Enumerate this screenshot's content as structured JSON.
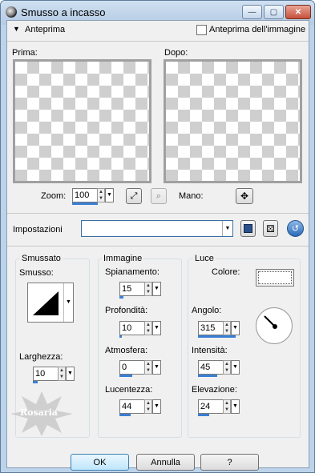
{
  "window": {
    "title": "Smusso a incasso"
  },
  "preview": {
    "toggle_label": "Anteprima",
    "image_preview_checkbox": "Anteprima dell'immagine",
    "before_label": "Prima:",
    "after_label": "Dopo:",
    "zoom_label": "Zoom:",
    "zoom_value": "100",
    "pan_label": "Mano:"
  },
  "settings": {
    "label": "Impostazioni",
    "value": ""
  },
  "bevel": {
    "group_label": "Smussato",
    "bevel_label": "Smusso:",
    "width_label": "Larghezza:",
    "width_value": "10",
    "width_fill": 0.2
  },
  "image": {
    "group_label": "Immagine",
    "smoothness_label": "Spianamento:",
    "smoothness_value": "15",
    "smoothness_fill": 0.15,
    "depth_label": "Profondità:",
    "depth_value": "10",
    "depth_fill": 0.1,
    "ambience_label": "Atmosfera:",
    "ambience_value": "0",
    "ambience_fill": 0.5,
    "shininess_label": "Lucentezza:",
    "shininess_value": "44",
    "shininess_fill": 0.44
  },
  "light": {
    "group_label": "Luce",
    "color_label": "Colore:",
    "color": "#ffffff",
    "angle_label": "Angolo:",
    "angle_value": "315",
    "angle_fill": 0.88,
    "intensity_label": "Intensità:",
    "intensity_value": "45",
    "intensity_fill": 0.45,
    "elevation_label": "Elevazione:",
    "elevation_value": "24",
    "elevation_fill": 0.27
  },
  "watermark": "Rosaria",
  "buttons": {
    "ok": "OK",
    "cancel": "Annulla",
    "help": "?"
  },
  "colors": {
    "accent": "#3a7fd4",
    "title_bg": "#bcd3ea"
  }
}
